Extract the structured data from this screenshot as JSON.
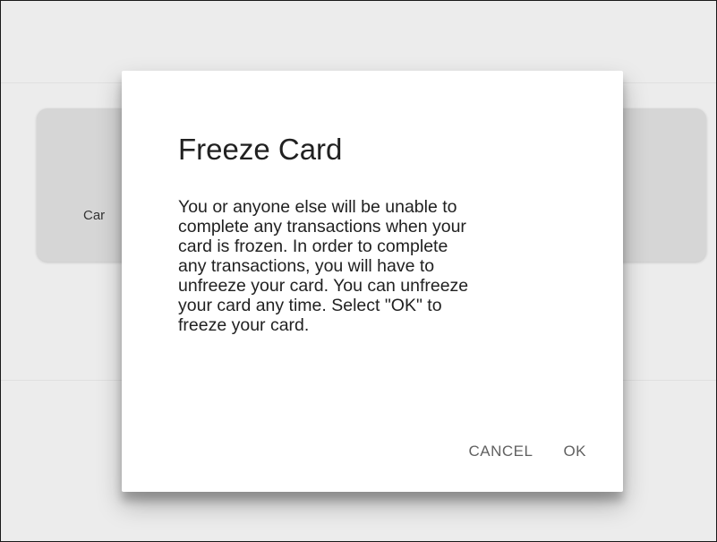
{
  "background": {
    "card_label": "Car"
  },
  "dialog": {
    "title": "Freeze Card",
    "body_lines": [
      "You or anyone else will be unable to",
      "complete any transactions when your",
      "card is frozen. In order to complete",
      "any transactions, you will have to",
      "unfreeze your card. You can unfreeze",
      "your card any time. Select \"OK\" to",
      "freeze your card."
    ],
    "cancel_label": "CANCEL",
    "ok_label": "OK"
  }
}
